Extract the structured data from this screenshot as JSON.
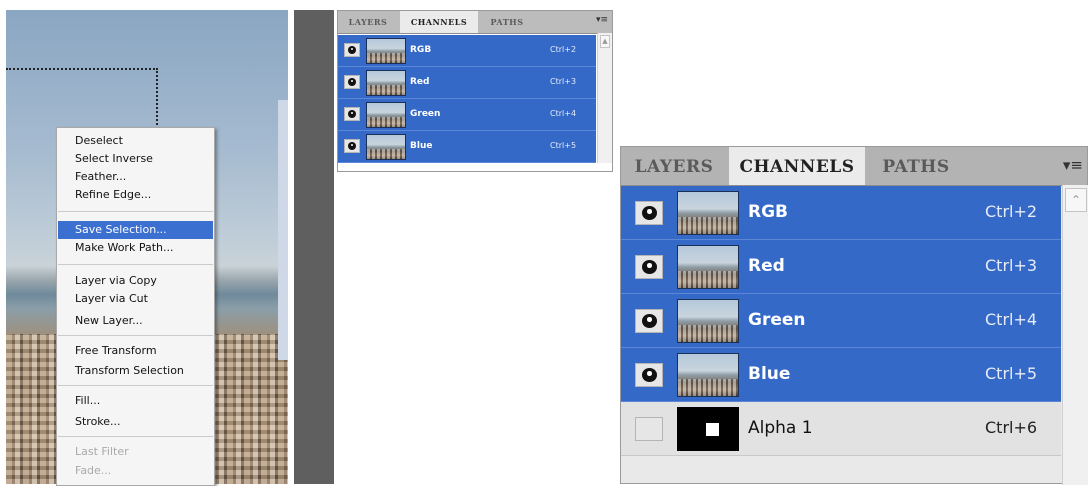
{
  "context_menu": {
    "items": [
      {
        "label": "Deselect"
      },
      {
        "label": "Select Inverse"
      },
      {
        "label": "Feather..."
      },
      {
        "label": "Refine Edge..."
      },
      {
        "label": "Save Selection..."
      },
      {
        "label": "Make Work Path..."
      },
      {
        "label": "Layer via Copy"
      },
      {
        "label": "Layer via Cut"
      },
      {
        "label": "New Layer..."
      },
      {
        "label": "Free Transform"
      },
      {
        "label": "Transform Selection"
      },
      {
        "label": "Fill..."
      },
      {
        "label": "Stroke..."
      },
      {
        "label": "Last Filter"
      },
      {
        "label": "Fade..."
      }
    ],
    "highlighted": "Save Selection...",
    "disabled": [
      "Last Filter",
      "Fade..."
    ]
  },
  "small_panel": {
    "tabs": [
      "LAYERS",
      "CHANNELS",
      "PATHS"
    ],
    "active_tab": "CHANNELS",
    "menu_icon": "panel-menu-icon",
    "channels": [
      {
        "name": "RGB",
        "shortcut": "Ctrl+2",
        "visible": true
      },
      {
        "name": "Red",
        "shortcut": "Ctrl+3",
        "visible": true
      },
      {
        "name": "Green",
        "shortcut": "Ctrl+4",
        "visible": true
      },
      {
        "name": "Blue",
        "shortcut": "Ctrl+5",
        "visible": true
      }
    ]
  },
  "big_panel": {
    "tabs": [
      "LAYERS",
      "CHANNELS",
      "PATHS"
    ],
    "active_tab": "CHANNELS",
    "menu_icon": "panel-menu-icon",
    "channels": [
      {
        "name": "RGB",
        "shortcut": "Ctrl+2",
        "visible": true
      },
      {
        "name": "Red",
        "shortcut": "Ctrl+3",
        "visible": true
      },
      {
        "name": "Green",
        "shortcut": "Ctrl+4",
        "visible": true
      },
      {
        "name": "Blue",
        "shortcut": "Ctrl+5",
        "visible": true
      },
      {
        "name": "Alpha 1",
        "shortcut": "Ctrl+6",
        "visible": false
      }
    ]
  },
  "colors": {
    "selection_blue": "#3569c7",
    "menu_highlight": "#3b6fd0",
    "panel_bg": "#ebebeb",
    "tab_bar": "#b3b3b3"
  }
}
